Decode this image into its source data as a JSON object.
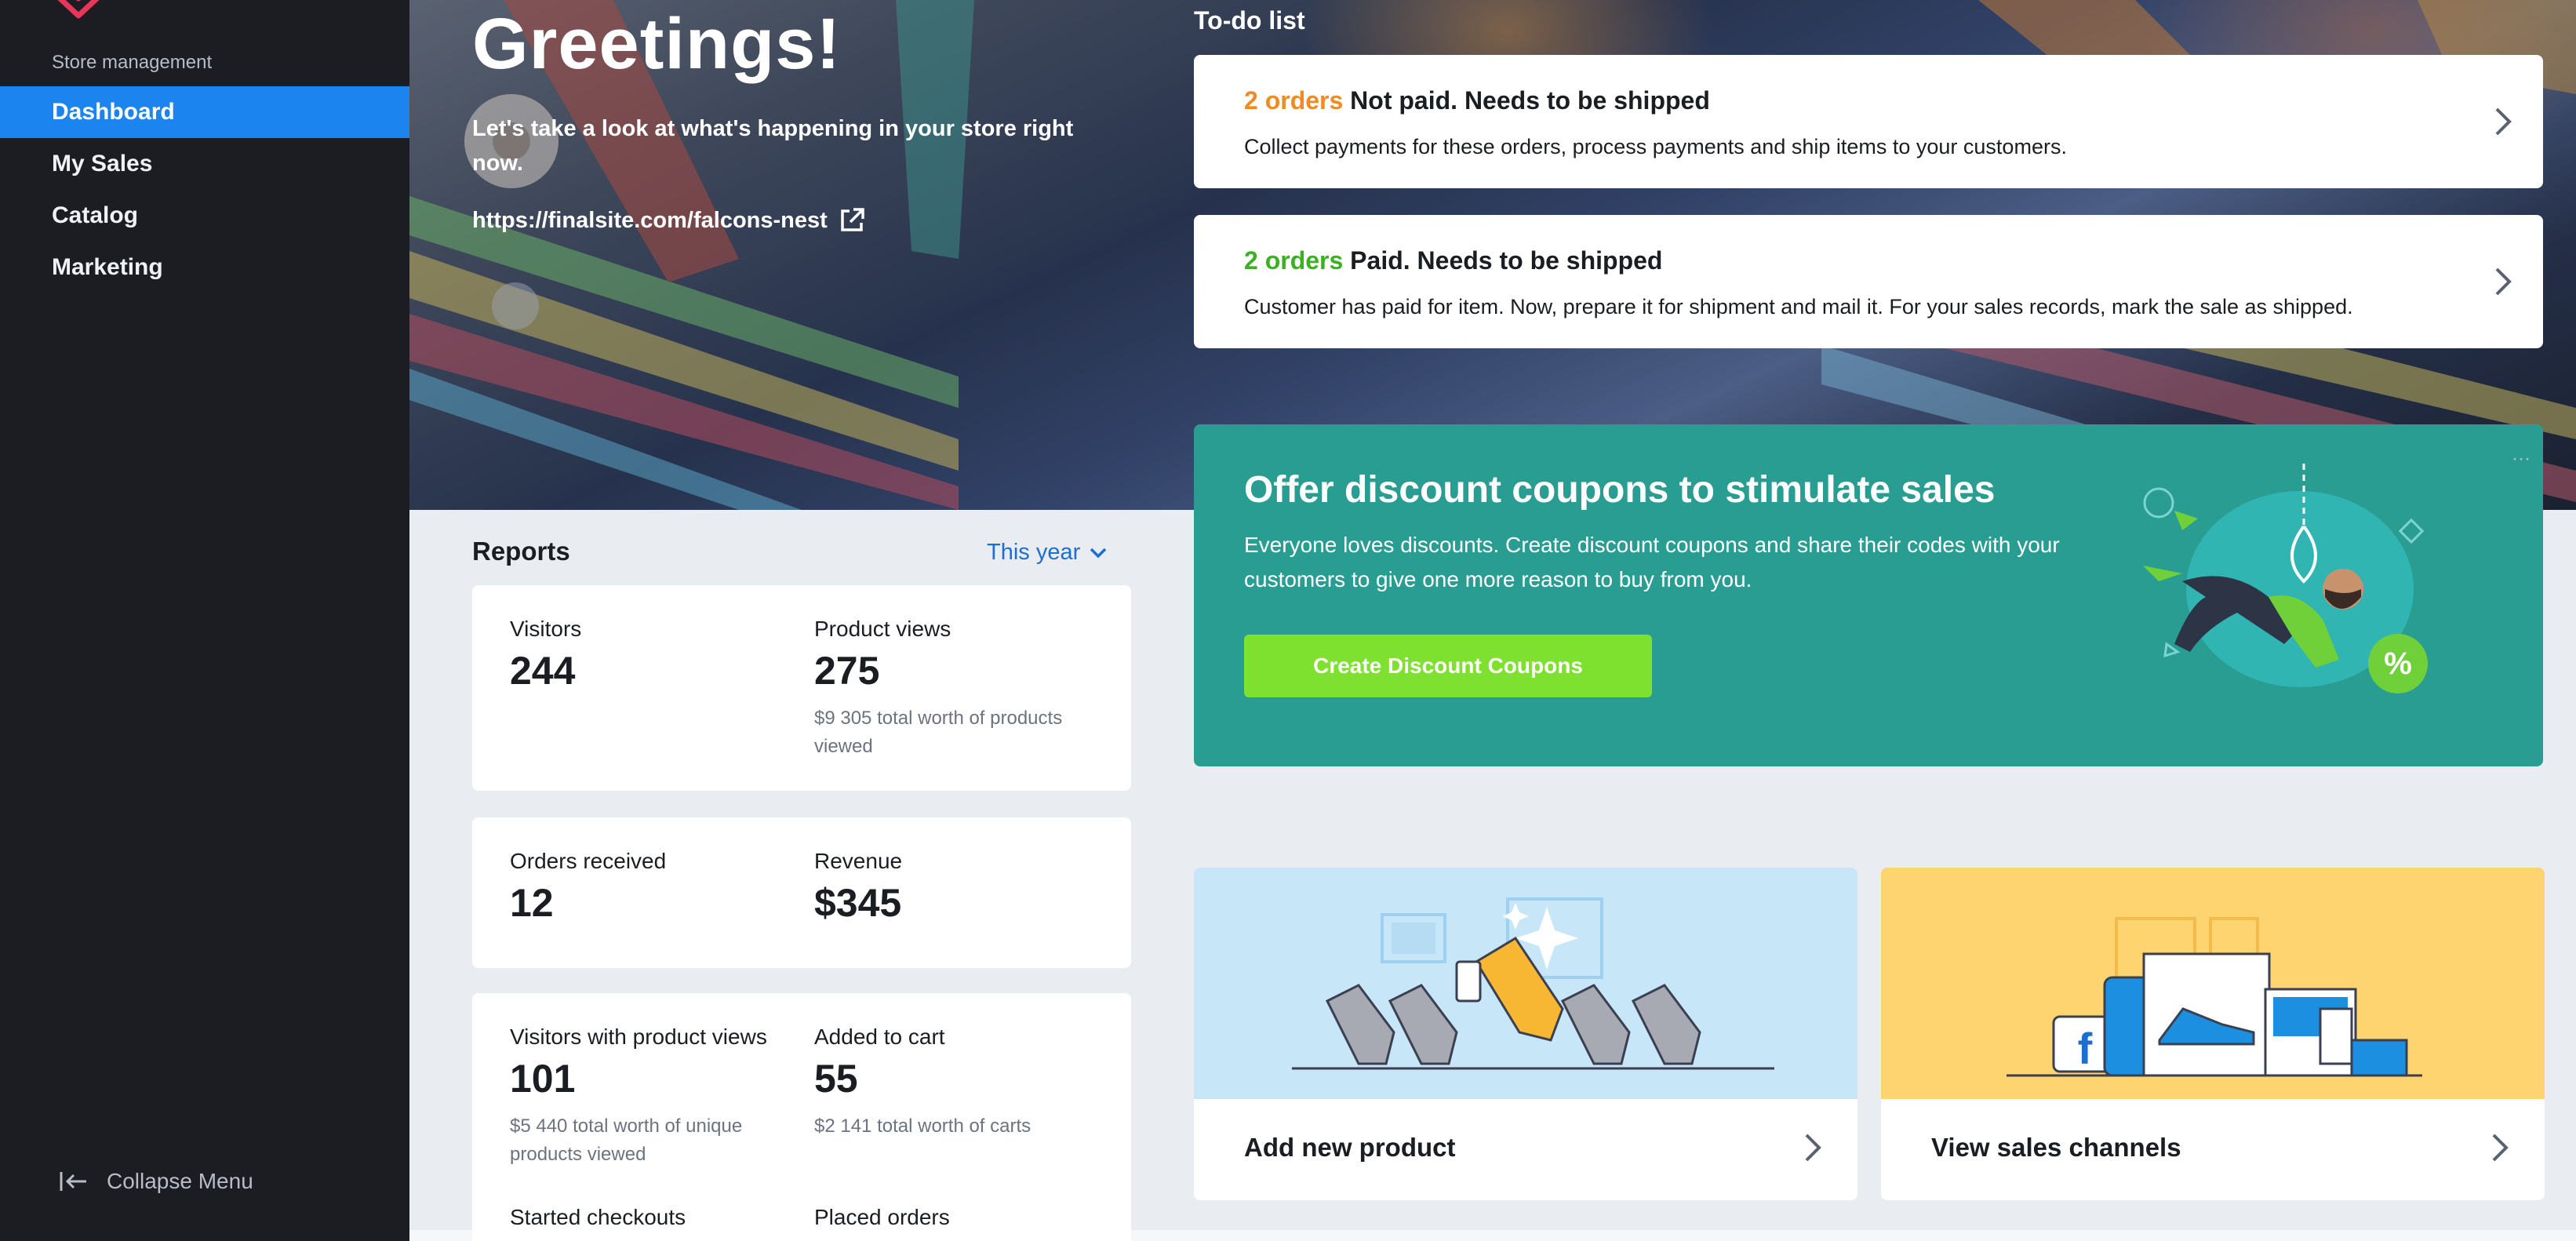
{
  "sidebar": {
    "section_label": "Store management",
    "items": [
      {
        "label": "Dashboard",
        "active": true
      },
      {
        "label": "My Sales",
        "active": false
      },
      {
        "label": "Catalog",
        "active": false
      },
      {
        "label": "Marketing",
        "active": false
      }
    ],
    "collapse_label": "Collapse Menu"
  },
  "hero": {
    "title": "Greetings!",
    "subtitle": "Let's take a look at what's happening in your store right now.",
    "store_url": "https://finalsite.com/falcons-nest"
  },
  "todo": {
    "title": "To-do list",
    "items": [
      {
        "count": "2 orders",
        "count_color": "#f08a24",
        "headline": "Not paid. Needs to be shipped",
        "description": "Collect payments for these orders, process payments and ship items to your customers."
      },
      {
        "count": "2 orders",
        "count_color": "#3cb023",
        "headline": "Paid. Needs to be shipped",
        "description": "Customer has paid for item. Now, prepare it for shipment and mail it. For your sales records, mark the sale as shipped."
      }
    ]
  },
  "promo": {
    "title": "Offer discount coupons to stimulate sales",
    "text": "Everyone loves discounts. Create discount coupons and share their codes with your customers to give one more reason to buy from you.",
    "button_label": "Create Discount Coupons",
    "badge_symbol": "%",
    "background_color": "#2a9d93",
    "button_color": "#7ee02f"
  },
  "reports": {
    "title": "Reports",
    "period": "This year",
    "cards": [
      {
        "metrics": [
          {
            "label": "Visitors",
            "value": "244",
            "note": ""
          },
          {
            "label": "Product views",
            "value": "275",
            "note": "$9 305 total worth of products viewed"
          }
        ]
      },
      {
        "metrics": [
          {
            "label": "Orders received",
            "value": "12",
            "note": ""
          },
          {
            "label": "Revenue",
            "value": "$345",
            "note": ""
          }
        ]
      },
      {
        "metrics": [
          {
            "label": "Visitors with product views",
            "value": "101",
            "note": "$5 440 total worth of unique products viewed"
          },
          {
            "label": "Added to cart",
            "value": "55",
            "note": "$2 141 total worth of carts"
          },
          {
            "label": "Started checkouts",
            "value": "",
            "note": ""
          },
          {
            "label": "Placed orders",
            "value": "",
            "note": ""
          }
        ]
      }
    ]
  },
  "tiles": [
    {
      "label": "Add new product",
      "background": "#c7e6f8"
    },
    {
      "label": "View sales channels",
      "background": "#fed470"
    }
  ],
  "colors": {
    "sidebar_bg": "#1b1d23",
    "active_nav": "#1c84ee",
    "link_blue": "#1c6fd1"
  }
}
